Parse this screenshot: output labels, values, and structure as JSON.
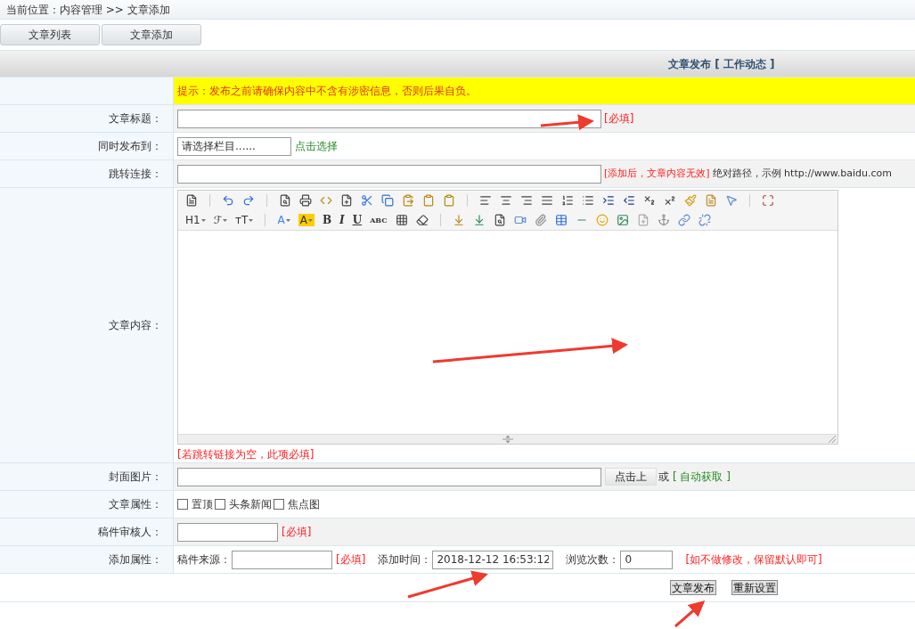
{
  "breadcrumb": "当前位置：内容管理 >> 文章添加",
  "tabs": [
    "文章列表",
    "文章添加"
  ],
  "header": "文章发布 [ 工作动态 ]",
  "notice": "提示：发布之前请确保内容中不含有涉密信息，否则后果自负。",
  "rows": [
    {
      "kind": "title",
      "label": "文章标题：",
      "value": "",
      "note": "[必填]"
    },
    {
      "kind": "publish_to",
      "label": "同时发布到：",
      "value": "请选择栏目......",
      "link": "点击选择"
    },
    {
      "kind": "redirect",
      "label": "跳转连接：",
      "value": "",
      "note": "[添加后，文章内容无效]",
      "hint": "绝对路径，示例 http://www.baidu.com"
    },
    {
      "kind": "content",
      "label": "文章内容：",
      "toolbar_text": [
        {
          "text": "H1",
          "caret": true
        },
        {
          "text": "ℱ",
          "caret": true
        },
        {
          "text": "ᴛT",
          "caret": true
        },
        {
          "text": "A",
          "caret": true,
          "color": "#3b82f6"
        },
        {
          "text": "A",
          "caret": true,
          "color": "#ffcc00"
        },
        {
          "text": "B",
          "caret": false
        },
        {
          "text": "I",
          "caret": false
        },
        {
          "text": "U",
          "caret": false
        },
        {
          "text": "ABC",
          "caret": false
        }
      ],
      "note": "[若跳转链接为空，此项必填]"
    },
    {
      "kind": "cover",
      "label": "封面图片：",
      "value": "",
      "button": "点击上",
      "or": "或",
      "link": "[ 自动获取 ]"
    },
    {
      "kind": "attributes",
      "label": "文章属性：",
      "options": [
        {
          "label": "置顶",
          "checked": false
        },
        {
          "label": "头条新闻",
          "checked": false
        },
        {
          "label": "焦点图",
          "checked": false
        }
      ]
    },
    {
      "kind": "reviewer",
      "label": "稿件审核人：",
      "value": "",
      "note": "[必填]"
    },
    {
      "kind": "extra",
      "label": "添加属性：",
      "source_label": "稿件来源：",
      "source_value": "",
      "source_note": "[必填]",
      "time_label": "添加时间：",
      "time_value": "2018-12-12 16:53:12",
      "views_label": "浏览次数：",
      "views_value": "0",
      "note": "[如不做修改，保留默认即可]"
    }
  ],
  "buttons": [
    "文章发布",
    "重新设置"
  ]
}
